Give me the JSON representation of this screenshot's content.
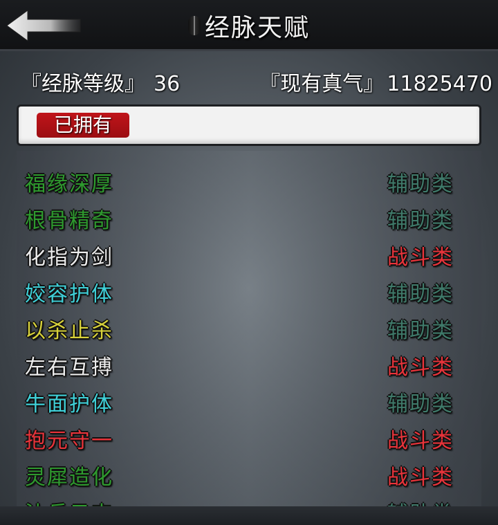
{
  "header": {
    "title": "经脉天赋",
    "title_icon": "exclamation-icon"
  },
  "stats": {
    "level_label": "『经脉等级』",
    "level_value": "36",
    "qi_label": "『现有真气』",
    "qi_value": "11825470"
  },
  "tabs": {
    "owned_label": "已拥有"
  },
  "colors": {
    "green": "#2e9a2e",
    "white": "#ececec",
    "cyan": "#3fd0d8",
    "yellow": "#d8d23a",
    "red": "#e8333a",
    "support_type": "#3f7a6a",
    "combat_type": "#e8333a"
  },
  "talents": [
    {
      "name": "福缘深厚",
      "type": "辅助类",
      "name_color": "#2e9a2e",
      "type_color": "#3f7a6a"
    },
    {
      "name": "根骨精奇",
      "type": "辅助类",
      "name_color": "#2e9a2e",
      "type_color": "#3f7a6a"
    },
    {
      "name": "化指为剑",
      "type": "战斗类",
      "name_color": "#ececec",
      "type_color": "#e8333a"
    },
    {
      "name": "姣容护体",
      "type": "辅助类",
      "name_color": "#3fd0d8",
      "type_color": "#3f7a6a"
    },
    {
      "name": "以杀止杀",
      "type": "辅助类",
      "name_color": "#d8d23a",
      "type_color": "#3f7a6a"
    },
    {
      "name": "左右互搏",
      "type": "战斗类",
      "name_color": "#ececec",
      "type_color": "#e8333a"
    },
    {
      "name": "牛面护体",
      "type": "辅助类",
      "name_color": "#3fd0d8",
      "type_color": "#3f7a6a"
    },
    {
      "name": "抱元守一",
      "type": "战斗类",
      "name_color": "#e8333a",
      "type_color": "#e8333a"
    },
    {
      "name": "灵犀造化",
      "type": "战斗类",
      "name_color": "#2e9a2e",
      "type_color": "#e8333a"
    },
    {
      "name": "沐兵云志",
      "type": "辅助类",
      "name_color": "#2e9a2e",
      "type_color": "#3f7a6a"
    }
  ]
}
